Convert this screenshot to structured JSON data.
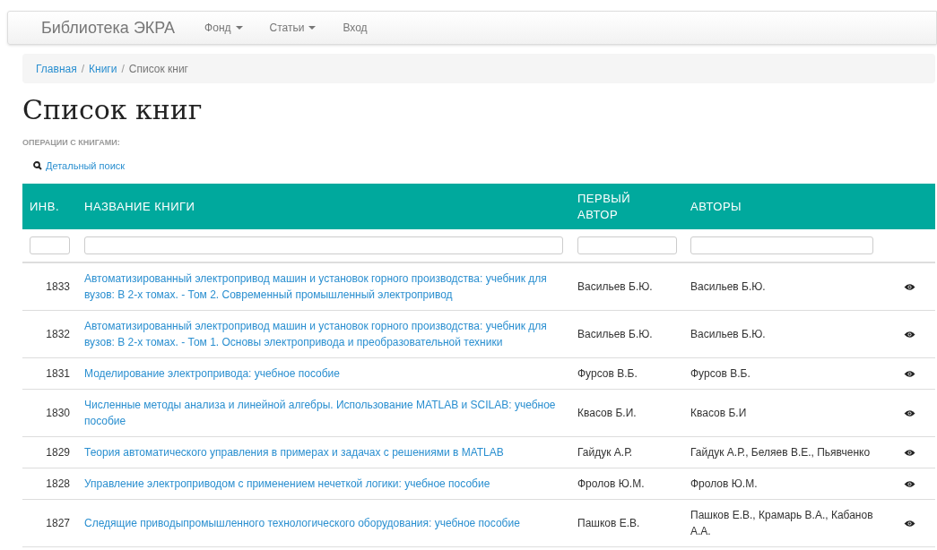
{
  "navbar": {
    "brand": "Библиотека ЭКРА",
    "items": [
      {
        "label": "Фонд",
        "dropdown": true
      },
      {
        "label": "Статьи",
        "dropdown": true
      },
      {
        "label": "Вход",
        "dropdown": false
      }
    ]
  },
  "breadcrumb": {
    "separator": "/",
    "items": [
      {
        "label": "Главная",
        "link": true
      },
      {
        "label": "Книги",
        "link": true
      },
      {
        "label": "Список книг",
        "link": false
      }
    ]
  },
  "heading": "Список книг",
  "operations": {
    "label": "ОПЕРАЦИИ С КНИГАМИ:",
    "links": [
      "Детальный поиск"
    ]
  },
  "table": {
    "columns": [
      "ИНВ.",
      "НАЗВАНИЕ КНИГИ",
      "ПЕРВЫЙ АВТОР",
      "АВТОРЫ"
    ],
    "rows": [
      {
        "inv": "1833",
        "title": "Автоматизированный электропривод машин и установок горного производства: учебник для вузов: В 2-х томах. - Том 2. Современный промышленный электропривод",
        "first_author": "Васильев Б.Ю.",
        "authors": "Васильев Б.Ю."
      },
      {
        "inv": "1832",
        "title": "Автоматизированный электропривод машин и установок горного производства: учебник для вузов: В 2-х томах. - Том 1. Основы электропривода и преобразовательной техники",
        "first_author": "Васильев Б.Ю.",
        "authors": "Васильев Б.Ю."
      },
      {
        "inv": "1831",
        "title": "Моделирование электропривода: учебное пособие",
        "first_author": "Фурсов В.Б.",
        "authors": "Фурсов В.Б."
      },
      {
        "inv": "1830",
        "title": "Численные методы анализа и линейной алгебры. Использование MATLAB и SCILAB: учебное пособие",
        "first_author": "Квасов Б.И.",
        "authors": "Квасов Б.И"
      },
      {
        "inv": "1829",
        "title": "Теория автоматического управления в примерах и задачах с решениями в MATLAB",
        "first_author": "Гайдук А.Р.",
        "authors": "Гайдук А.Р., Беляев В.Е., Пьявченко"
      },
      {
        "inv": "1828",
        "title": "Управление электроприводом с применением нечеткой логики: учебное пособие",
        "first_author": "Фролов Ю.М.",
        "authors": "Фролов Ю.М."
      },
      {
        "inv": "1827",
        "title": "Следящие приводыпромышленного технологического оборудования: учебное пособие",
        "first_author": "Пашков Е.В.",
        "authors": "Пашков Е.В., Крамарь В.А., Кабанов А.А."
      }
    ]
  }
}
